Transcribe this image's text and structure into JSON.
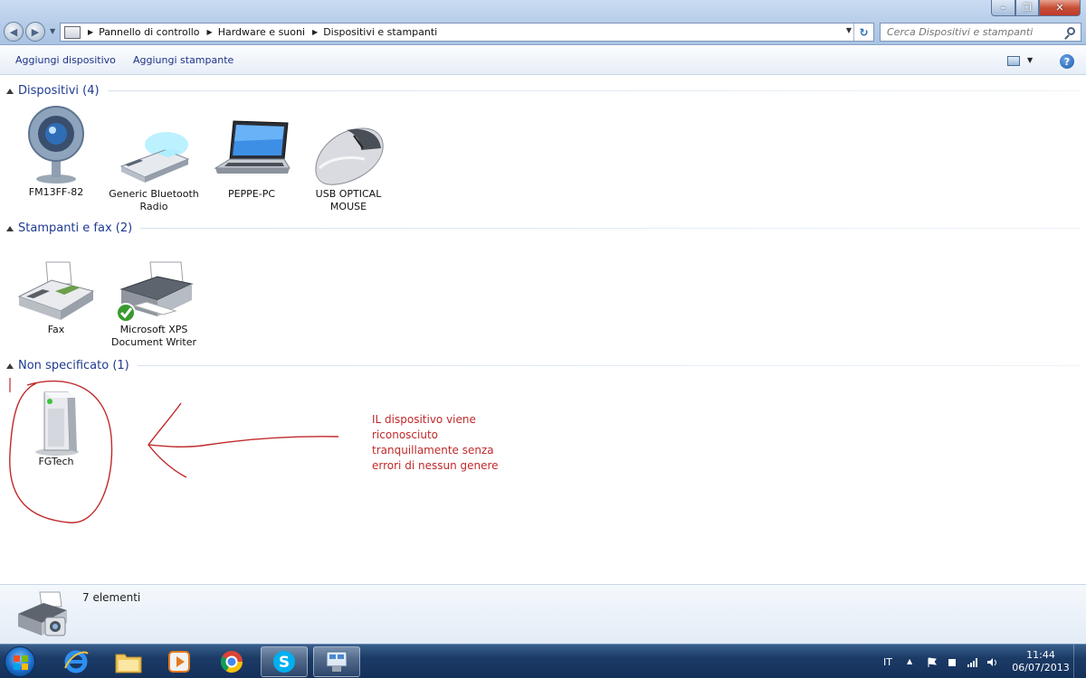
{
  "window": {
    "minimize_icon": "minimize-icon",
    "maximize_icon": "restore-icon",
    "close_icon": "close-icon"
  },
  "addressbar": {
    "breadcrumbs": [
      "Pannello di controllo",
      "Hardware e suoni",
      "Dispositivi e stampanti"
    ]
  },
  "search": {
    "placeholder": "Cerca Dispositivi e stampanti"
  },
  "commandbar": {
    "add_device": "Aggiungi dispositivo",
    "add_printer": "Aggiungi stampante"
  },
  "groups": [
    {
      "title": "Dispositivi (4)",
      "items": [
        {
          "label": "FM13FF-82",
          "icon": "webcam-icon"
        },
        {
          "label": "Generic Bluetooth Radio",
          "icon": "usb-bluetooth-icon"
        },
        {
          "label": "PEPPE-PC",
          "icon": "laptop-icon"
        },
        {
          "label": "USB OPTICAL MOUSE",
          "icon": "mouse-icon"
        }
      ]
    },
    {
      "title": "Stampanti e fax (2)",
      "items": [
        {
          "label": "Fax",
          "icon": "fax-icon"
        },
        {
          "label": "Microsoft XPS Document Writer",
          "icon": "printer-default-icon"
        }
      ]
    },
    {
      "title": "Non specificato (1)",
      "items": [
        {
          "label": "FGTech",
          "icon": "generic-device-icon"
        }
      ]
    }
  ],
  "annotation": {
    "text": "IL dispositivo viene riconosciuto tranquillamente senza errori di nessun genere",
    "color": "#c0292b"
  },
  "details": {
    "count": "7 elementi"
  },
  "taskbar": {
    "apps": [
      "internet-explorer-icon",
      "file-explorer-icon",
      "media-player-icon",
      "chrome-icon",
      "skype-icon",
      "devices-printers-icon"
    ],
    "language": "IT",
    "time": "11:44",
    "date": "06/07/2013"
  }
}
